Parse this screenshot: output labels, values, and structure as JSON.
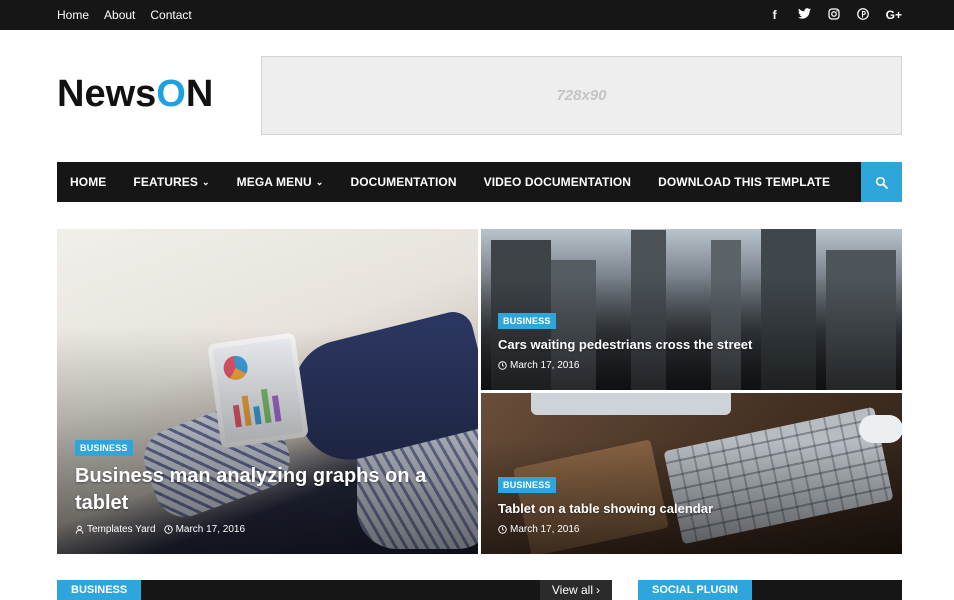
{
  "topbar": {
    "links": [
      "Home",
      "About",
      "Contact"
    ],
    "social_icons": [
      {
        "icon": "facebook-icon",
        "glyph": "f"
      },
      {
        "icon": "twitter-icon",
        "glyph": "t"
      },
      {
        "icon": "instagram-icon",
        "glyph": "◎"
      },
      {
        "icon": "pinterest-icon",
        "glyph": "℗"
      },
      {
        "icon": "google-plus-icon",
        "glyph": "G+"
      }
    ]
  },
  "header": {
    "logo_part1": "News",
    "logo_part2": "O",
    "logo_part3": "N",
    "ad_label": "728x90"
  },
  "nav": {
    "items": [
      {
        "label": "HOME",
        "dropdown": false
      },
      {
        "label": "FEATURES",
        "dropdown": true
      },
      {
        "label": "MEGA MENU",
        "dropdown": true
      },
      {
        "label": "DOCUMENTATION",
        "dropdown": false
      },
      {
        "label": "VIDEO DOCUMENTATION",
        "dropdown": false
      },
      {
        "label": "DOWNLOAD THIS TEMPLATE",
        "dropdown": false
      }
    ],
    "search_icon": "search-icon"
  },
  "featured": {
    "main": {
      "category": "BUSINESS",
      "title": "Business man analyzing graphs on a tablet",
      "author": "Templates Yard",
      "date": "March 17, 2016"
    },
    "right_top": {
      "category": "BUSINESS",
      "title": "Cars waiting pedestrians cross the street",
      "date": "March 17, 2016"
    },
    "right_bottom": {
      "category": "BUSINESS",
      "title": "Tablet on a table showing calendar",
      "date": "March 17, 2016"
    }
  },
  "sections": {
    "business_label": "BUSINESS",
    "view_all": "View all",
    "social_label": "SOCIAL PLUGIN"
  },
  "colors": {
    "accent": "#2fa6db",
    "dark": "#161616"
  }
}
